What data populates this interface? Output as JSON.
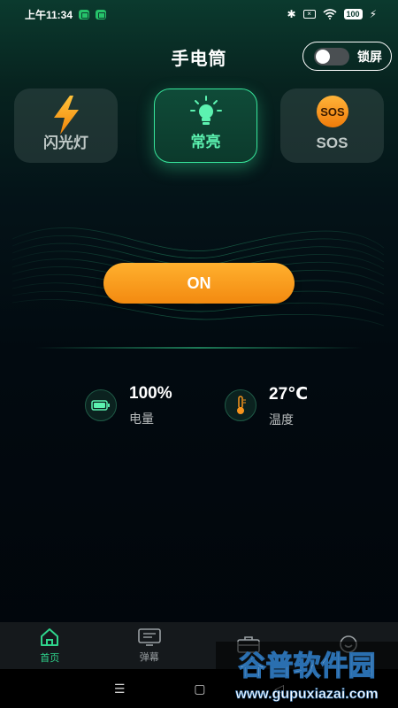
{
  "status_bar": {
    "time": "上午11:34",
    "battery": "100"
  },
  "header": {
    "title": "手电筒",
    "lock_label": "锁屏",
    "lock_enabled": false
  },
  "modes": [
    {
      "label": "闪光灯",
      "icon": "lightning-icon",
      "active": false
    },
    {
      "label": "常亮",
      "icon": "bulb-icon",
      "active": true
    },
    {
      "label": "SOS",
      "icon": "sos-icon",
      "icon_text": "SOS",
      "active": false
    }
  ],
  "main": {
    "on_label": "ON"
  },
  "stats": {
    "battery": {
      "value": "100%",
      "label": "电量",
      "icon": "battery-icon"
    },
    "temperature": {
      "value": "27℃",
      "label": "温度",
      "icon": "thermometer-icon"
    }
  },
  "bottom_nav": [
    {
      "label": "首页",
      "icon": "home-icon",
      "active": true
    },
    {
      "label": "弹幕",
      "icon": "barrage-icon",
      "active": false
    },
    {
      "label": "",
      "icon": "toolbox-icon",
      "active": false
    },
    {
      "label": "",
      "icon": "profile-icon",
      "active": false
    }
  ],
  "watermark": {
    "title": "谷普软件园",
    "url": "www.gupuxiazai.com"
  },
  "colors": {
    "accent": "#37e59b",
    "on_button": "#f79a17",
    "background": "#02070b"
  }
}
